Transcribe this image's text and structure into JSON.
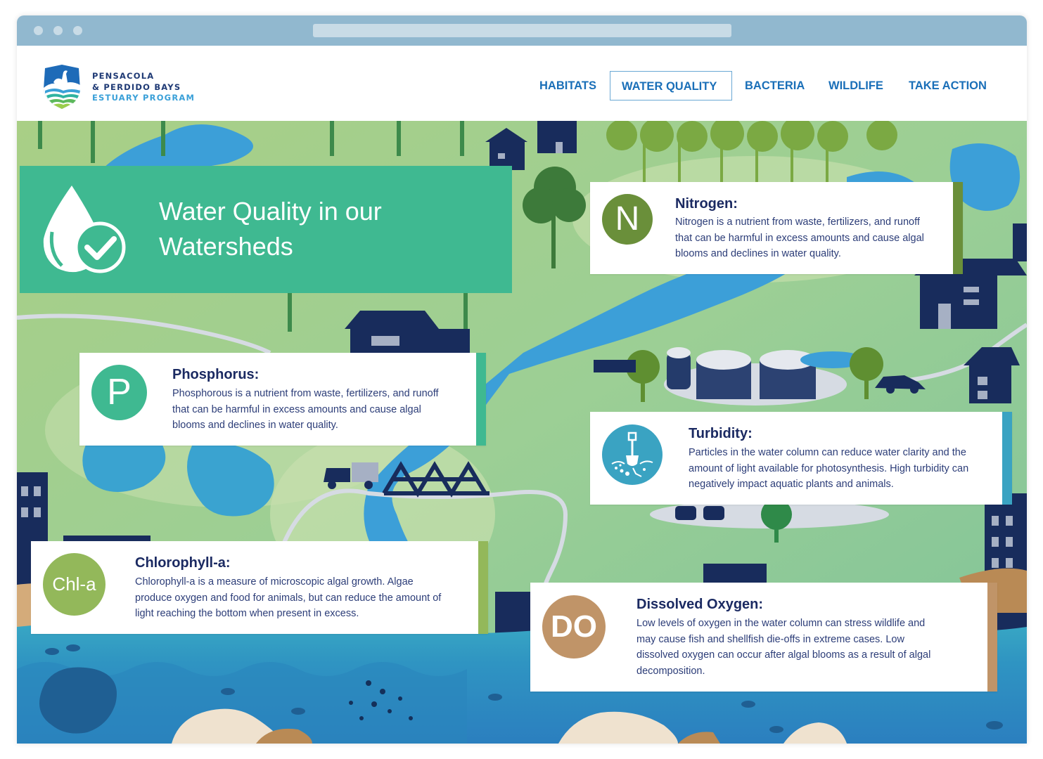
{
  "browser": {
    "window_dots": 3
  },
  "brand": {
    "line1": "PENSACOLA",
    "line2": "& PERDIDO BAYS",
    "line3": "ESTUARY PROGRAM",
    "logo_icon": "pelican-shield-icon"
  },
  "nav": {
    "items": [
      {
        "label": "HABITATS",
        "active": false
      },
      {
        "label": "WATER QUALITY",
        "active": true
      },
      {
        "label": "BACTERIA",
        "active": false
      },
      {
        "label": "WILDLIFE",
        "active": false
      },
      {
        "label": "TAKE ACTION",
        "active": false
      }
    ]
  },
  "hero": {
    "title_line1": "Water Quality in our",
    "title_line2": "Watersheds",
    "icon": "water-drop-check-icon"
  },
  "cards": {
    "nitrogen": {
      "badge": "N",
      "title": "Nitrogen:",
      "body": "Nitrogen is a nutrient from waste, fertilizers, and runoff that can be harmful in excess amounts and cause algal blooms and declines in water quality.",
      "color": "#6a8f3a"
    },
    "phosphorus": {
      "badge": "P",
      "title": "Phosphorus:",
      "body": "Phosphorous is a nutrient from waste, fertilizers, and runoff that can be harmful in excess amounts and cause algal blooms and declines in water quality.",
      "color": "#3fb991"
    },
    "turbidity": {
      "badge_icon": "shovel-soil-icon",
      "title": "Turbidity:",
      "body": "Particles in the water column can reduce water clarity and the amount of light available for photosynthesis. High turbidity can negatively impact aquatic plants and animals.",
      "color": "#3aa3c2"
    },
    "chlorophyll": {
      "badge": "Chl-a",
      "title": "Chlorophyll-a:",
      "body": "Chlorophyll-a is a measure of microscopic algal growth. Algae produce oxygen and food for animals, but can reduce the amount of light reaching the bottom when present in excess.",
      "color": "#93b85a"
    },
    "oxygen": {
      "badge": "DO",
      "title": "Dissolved Oxygen:",
      "body": "Low levels of oxygen in the water column can stress wildlife and may cause fish and shellfish die-offs in extreme cases. Low dissolved oxygen can occur after algal blooms as a result of algal decomposition.",
      "color": "#c09468"
    }
  },
  "colors": {
    "chrome": "#91b8cf",
    "nav_text": "#1a6fb8",
    "hero_bg": "#3fb991",
    "card_title": "#1b2a62",
    "navy": "#182c5c",
    "river": "#3c9fd8"
  }
}
